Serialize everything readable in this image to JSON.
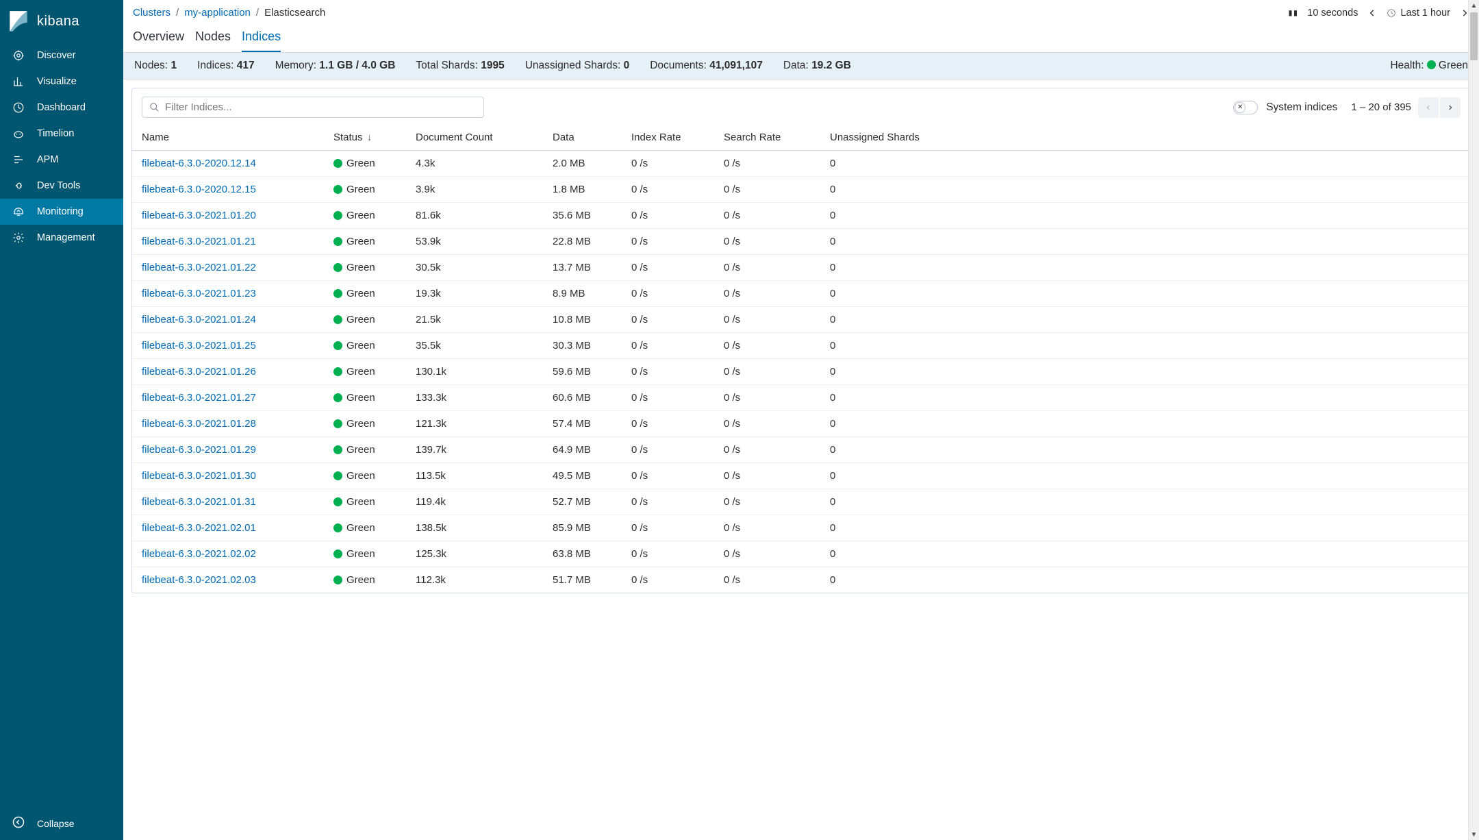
{
  "brand": {
    "name": "kibana"
  },
  "sidebar": {
    "items": [
      {
        "label": "Discover"
      },
      {
        "label": "Visualize"
      },
      {
        "label": "Dashboard"
      },
      {
        "label": "Timelion"
      },
      {
        "label": "APM"
      },
      {
        "label": "Dev Tools"
      },
      {
        "label": "Monitoring"
      },
      {
        "label": "Management"
      }
    ],
    "active_index": 6,
    "collapse_label": "Collapse"
  },
  "breadcrumbs": {
    "items": [
      "Clusters",
      "my-application",
      "Elasticsearch"
    ]
  },
  "time": {
    "refresh_interval": "10 seconds",
    "range": "Last 1 hour"
  },
  "tabs": {
    "items": [
      "Overview",
      "Nodes",
      "Indices"
    ],
    "active_index": 2
  },
  "stats": {
    "nodes_label": "Nodes:",
    "nodes": "1",
    "indices_label": "Indices:",
    "indices": "417",
    "memory_label": "Memory:",
    "memory": "1.1 GB / 4.0 GB",
    "total_shards_label": "Total Shards:",
    "total_shards": "1995",
    "unassigned_label": "Unassigned Shards:",
    "unassigned": "0",
    "documents_label": "Documents:",
    "documents": "41,091,107",
    "data_label": "Data:",
    "data": "19.2 GB",
    "health_label": "Health:",
    "health": "Green"
  },
  "toolbar": {
    "filter_placeholder": "Filter Indices...",
    "system_indices_label": "System indices",
    "pagination": "1 – 20 of 395"
  },
  "columns": [
    "Name",
    "Status",
    "Document Count",
    "Data",
    "Index Rate",
    "Search Rate",
    "Unassigned Shards"
  ],
  "sort": {
    "column_index": 1,
    "dir": "desc"
  },
  "rows": [
    {
      "name": "filebeat-6.3.0-2020.12.14",
      "status": "Green",
      "docs": "4.3k",
      "data": "2.0 MB",
      "index_rate": "0 /s",
      "search_rate": "0 /s",
      "unassigned": "0"
    },
    {
      "name": "filebeat-6.3.0-2020.12.15",
      "status": "Green",
      "docs": "3.9k",
      "data": "1.8 MB",
      "index_rate": "0 /s",
      "search_rate": "0 /s",
      "unassigned": "0"
    },
    {
      "name": "filebeat-6.3.0-2021.01.20",
      "status": "Green",
      "docs": "81.6k",
      "data": "35.6 MB",
      "index_rate": "0 /s",
      "search_rate": "0 /s",
      "unassigned": "0"
    },
    {
      "name": "filebeat-6.3.0-2021.01.21",
      "status": "Green",
      "docs": "53.9k",
      "data": "22.8 MB",
      "index_rate": "0 /s",
      "search_rate": "0 /s",
      "unassigned": "0"
    },
    {
      "name": "filebeat-6.3.0-2021.01.22",
      "status": "Green",
      "docs": "30.5k",
      "data": "13.7 MB",
      "index_rate": "0 /s",
      "search_rate": "0 /s",
      "unassigned": "0"
    },
    {
      "name": "filebeat-6.3.0-2021.01.23",
      "status": "Green",
      "docs": "19.3k",
      "data": "8.9 MB",
      "index_rate": "0 /s",
      "search_rate": "0 /s",
      "unassigned": "0"
    },
    {
      "name": "filebeat-6.3.0-2021.01.24",
      "status": "Green",
      "docs": "21.5k",
      "data": "10.8 MB",
      "index_rate": "0 /s",
      "search_rate": "0 /s",
      "unassigned": "0"
    },
    {
      "name": "filebeat-6.3.0-2021.01.25",
      "status": "Green",
      "docs": "35.5k",
      "data": "30.3 MB",
      "index_rate": "0 /s",
      "search_rate": "0 /s",
      "unassigned": "0"
    },
    {
      "name": "filebeat-6.3.0-2021.01.26",
      "status": "Green",
      "docs": "130.1k",
      "data": "59.6 MB",
      "index_rate": "0 /s",
      "search_rate": "0 /s",
      "unassigned": "0"
    },
    {
      "name": "filebeat-6.3.0-2021.01.27",
      "status": "Green",
      "docs": "133.3k",
      "data": "60.6 MB",
      "index_rate": "0 /s",
      "search_rate": "0 /s",
      "unassigned": "0"
    },
    {
      "name": "filebeat-6.3.0-2021.01.28",
      "status": "Green",
      "docs": "121.3k",
      "data": "57.4 MB",
      "index_rate": "0 /s",
      "search_rate": "0 /s",
      "unassigned": "0"
    },
    {
      "name": "filebeat-6.3.0-2021.01.29",
      "status": "Green",
      "docs": "139.7k",
      "data": "64.9 MB",
      "index_rate": "0 /s",
      "search_rate": "0 /s",
      "unassigned": "0"
    },
    {
      "name": "filebeat-6.3.0-2021.01.30",
      "status": "Green",
      "docs": "113.5k",
      "data": "49.5 MB",
      "index_rate": "0 /s",
      "search_rate": "0 /s",
      "unassigned": "0"
    },
    {
      "name": "filebeat-6.3.0-2021.01.31",
      "status": "Green",
      "docs": "119.4k",
      "data": "52.7 MB",
      "index_rate": "0 /s",
      "search_rate": "0 /s",
      "unassigned": "0"
    },
    {
      "name": "filebeat-6.3.0-2021.02.01",
      "status": "Green",
      "docs": "138.5k",
      "data": "85.9 MB",
      "index_rate": "0 /s",
      "search_rate": "0 /s",
      "unassigned": "0"
    },
    {
      "name": "filebeat-6.3.0-2021.02.02",
      "status": "Green",
      "docs": "125.3k",
      "data": "63.8 MB",
      "index_rate": "0 /s",
      "search_rate": "0 /s",
      "unassigned": "0"
    },
    {
      "name": "filebeat-6.3.0-2021.02.03",
      "status": "Green",
      "docs": "112.3k",
      "data": "51.7 MB",
      "index_rate": "0 /s",
      "search_rate": "0 /s",
      "unassigned": "0"
    }
  ]
}
